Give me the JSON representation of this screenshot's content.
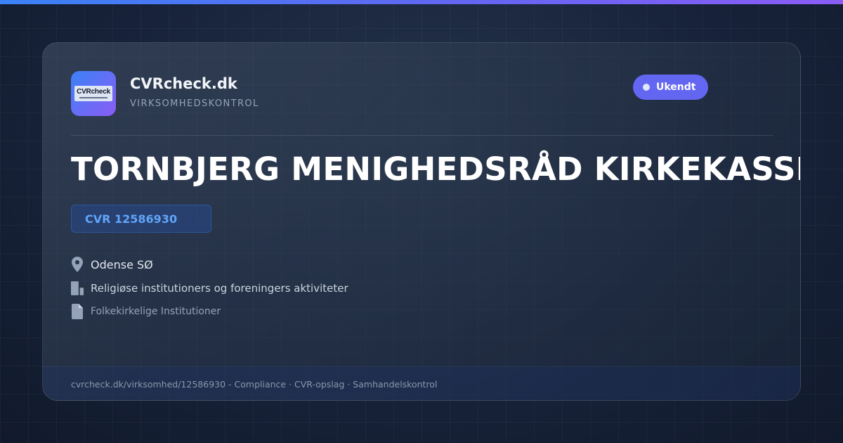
{
  "brand": {
    "logo_text": "CVRcheck",
    "name": "CVRcheck.dk",
    "tagline": "VIRKSOMHEDSKONTROL"
  },
  "status": {
    "label": "Ukendt"
  },
  "company": {
    "name": "TORNBJERG MENIGHEDSRÅD KIRKEKASSEN",
    "cvr": "CVR 12586930",
    "location": "Odense SØ",
    "industry": "Religiøse institutioners og foreningers aktiviteter",
    "company_type": "Folkekirkelige Institutioner"
  },
  "footer": {
    "text": "cvrcheck.dk/virksomhed/12586930 - Compliance · CVR-opslag · Samhandelskontrol"
  },
  "icons": {
    "location": "map-pin-icon",
    "industry": "building-icon",
    "type": "document-icon"
  },
  "colors": {
    "accent": "#6366f1",
    "cvr_blue": "#60a5fa",
    "gradient_start": "#3b82f6",
    "gradient_end": "#8b5cf6"
  }
}
